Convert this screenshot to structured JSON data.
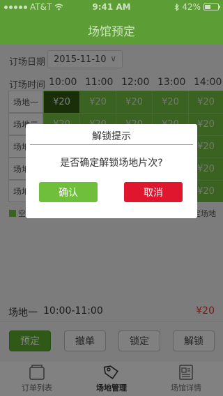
{
  "status": {
    "carrier": "AT&T",
    "time": "9:41 AM",
    "battery": "42%"
  },
  "nav": {
    "title": "场馆预定"
  },
  "filters": {
    "date_label": "订场日期",
    "date_value": "2015-11-10"
  },
  "schedule": {
    "time_label": "订场时间",
    "times": [
      "10:00",
      "11:00",
      "12:00",
      "13:00",
      "14:00"
    ],
    "venues": [
      "场地一",
      "场地二",
      "场地三",
      "场地四",
      "场地五"
    ],
    "price": "¥20"
  },
  "legend": {
    "left": "空",
    "right": "定场地"
  },
  "selection": {
    "venue": "场地一",
    "time": "10:00-11:00",
    "price": "¥20"
  },
  "actions": {
    "book": "预定",
    "cancel": "撤单",
    "lock": "锁定",
    "unlock": "解锁"
  },
  "tabs": [
    {
      "label": "订单列表"
    },
    {
      "label": "场地管理"
    },
    {
      "label": "场馆详情"
    }
  ],
  "dialog": {
    "title": "解锁提示",
    "message": "是否确定解锁场地片次?",
    "confirm": "确认",
    "cancel": "取消"
  },
  "colors": {
    "nav": "#5c9d35",
    "cell": "#6fbc3f",
    "selected": "#2f5a12",
    "confirm": "#6fbf3b",
    "cancel": "#e0152e",
    "price": "#d93a2b"
  }
}
